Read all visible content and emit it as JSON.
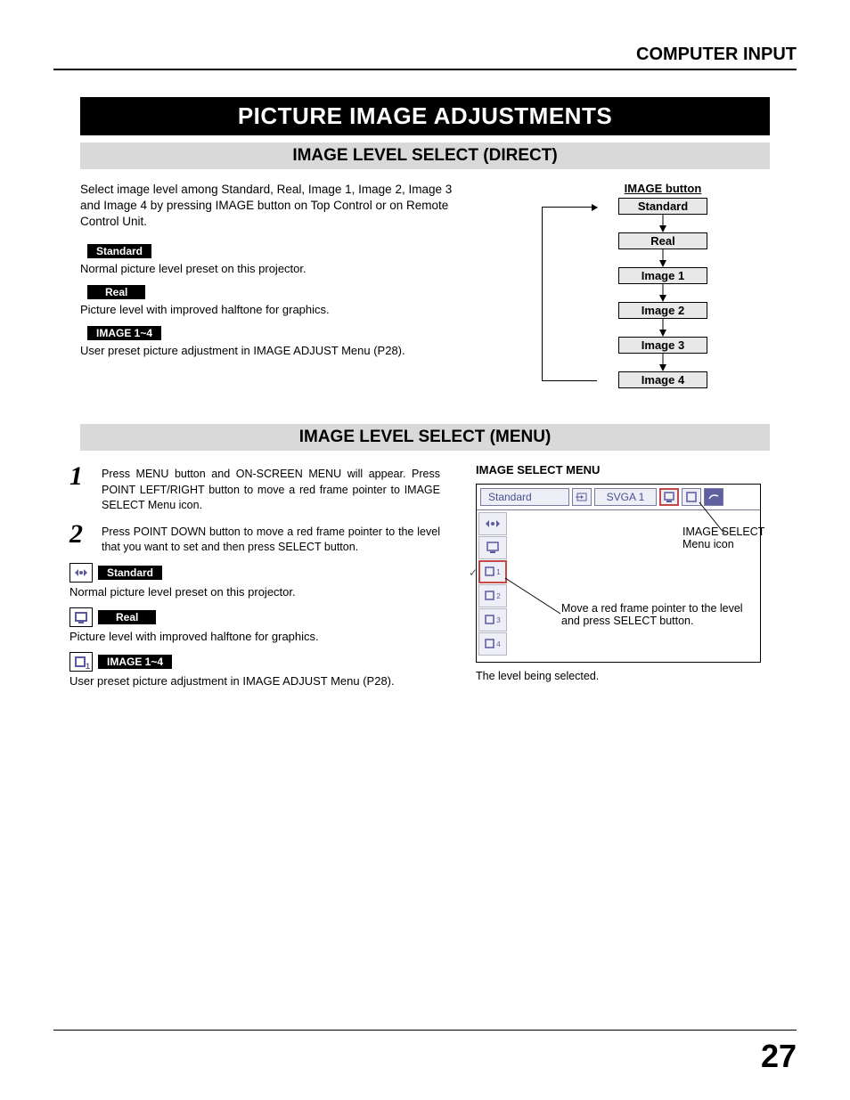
{
  "header": {
    "section": "COMPUTER INPUT"
  },
  "title": "PICTURE IMAGE ADJUSTMENTS",
  "section1": {
    "heading": "IMAGE LEVEL SELECT (DIRECT)",
    "intro": "Select image level among Standard, Real, Image 1, Image 2, Image 3 and Image 4 by pressing IMAGE button on Top Control or on Remote Control Unit.",
    "modes": [
      {
        "label": "Standard",
        "desc": "Normal picture level preset on this projector."
      },
      {
        "label": "Real",
        "desc": "Picture level with improved halftone for graphics."
      },
      {
        "label": "IMAGE 1~4",
        "desc": "User preset picture adjustment in IMAGE ADJUST Menu (P28)."
      }
    ],
    "flow": {
      "title": "IMAGE button",
      "items": [
        "Standard",
        "Real",
        "Image 1",
        "Image 2",
        "Image 3",
        "Image 4"
      ]
    }
  },
  "section2": {
    "heading": "IMAGE LEVEL SELECT (MENU)",
    "steps": [
      {
        "num": "1",
        "text": "Press MENU button and ON-SCREEN MENU will appear.  Press POINT LEFT/RIGHT button to move a red frame pointer to IMAGE SELECT Menu icon."
      },
      {
        "num": "2",
        "text": "Press POINT DOWN button to move a red frame pointer to the level that you want to set and then press SELECT button."
      }
    ],
    "modes": [
      {
        "label": "Standard",
        "desc": "Normal picture level preset on this projector."
      },
      {
        "label": "Real",
        "desc": "Picture level with improved halftone for graphics."
      },
      {
        "label": "IMAGE 1~4",
        "desc": "User preset picture adjustment in IMAGE ADJUST Menu (P28)."
      }
    ],
    "menu": {
      "heading": "IMAGE SELECT MENU",
      "topbar": {
        "mode": "Standard",
        "signal": "SVGA 1"
      },
      "callout1": "IMAGE SELECT Menu icon",
      "callout2": "Move a red frame pointer to the level and press SELECT button.",
      "caption": "The level being selected."
    }
  },
  "pageNumber": "27"
}
